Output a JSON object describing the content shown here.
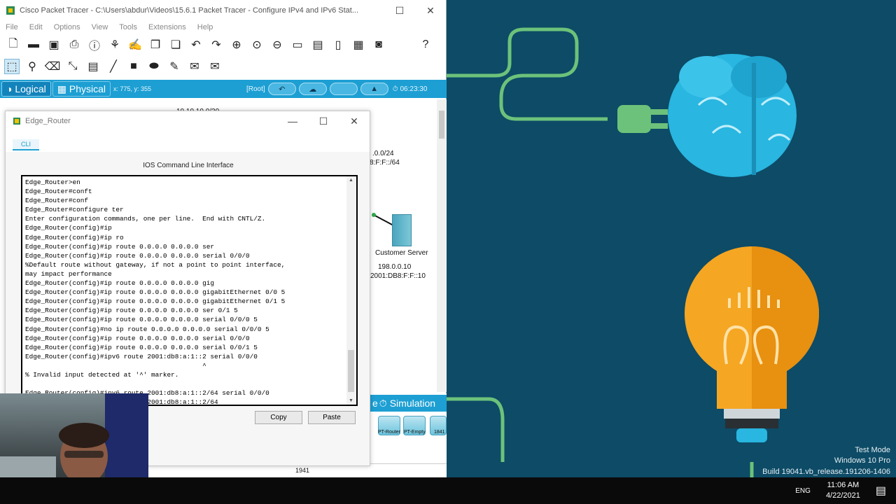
{
  "pt_window": {
    "title": "Cisco Packet Tracer - C:\\Users\\abdur\\Videos\\15.6.1 Packet Tracer - Configure IPv4 and IPv6 Stat...",
    "menu": [
      "File",
      "Edit",
      "Options",
      "View",
      "Tools",
      "Extensions",
      "Help"
    ],
    "help_label": "?"
  },
  "nav": {
    "logical_label": "Logical",
    "physical_label": "Physical",
    "coords": "x: 775, y: 355",
    "root_label": "[Root]",
    "time": "06:23:30"
  },
  "workspace": {
    "top_label": "10.10.10.0/30",
    "net_label_1": ".0.0/24",
    "net_label_2": "8:F:F::/64",
    "server_name": "Customer Server",
    "server_ipv4": "198.0.0.10",
    "server_ipv6": "2001:DB8:F:F::10",
    "bottom_device": "1941",
    "simulation_label": "Simulation",
    "realtime_partial": "e",
    "devices": [
      "PT-Router",
      "PT-Empty",
      "1841"
    ]
  },
  "dialog": {
    "title": "Edge_Router",
    "cli_tab": "CLI",
    "heading": "IOS Command Line Interface",
    "copy_label": "Copy",
    "paste_label": "Paste",
    "terminal_lines": [
      "Edge_Router>en",
      "Edge_Router#conft",
      "Edge_Router#conf",
      "Edge_Router#configure ter",
      "Enter configuration commands, one per line.  End with CNTL/Z.",
      "Edge_Router(config)#ip",
      "Edge_Router(config)#ip ro",
      "Edge_Router(config)#ip route 0.0.0.0 0.0.0.0 ser",
      "Edge_Router(config)#ip route 0.0.0.0 0.0.0.0 serial 0/0/0",
      "%Default route without gateway, if not a point to point interface,",
      "may impact performance",
      "Edge_Router(config)#ip route 0.0.0.0 0.0.0.0 gig",
      "Edge_Router(config)#ip route 0.0.0.0 0.0.0.0 gigabitEthernet 0/0 5",
      "Edge_Router(config)#ip route 0.0.0.0 0.0.0.0 gigabitEthernet 0/1 5",
      "Edge_Router(config)#ip route 0.0.0.0 0.0.0.0 ser 0/1 5",
      "Edge_Router(config)#ip route 0.0.0.0 0.0.0.0 serial 0/0/0 5",
      "Edge_Router(config)#no ip route 0.0.0.0 0.0.0.0 serial 0/0/0 5",
      "Edge_Router(config)#ip route 0.0.0.0 0.0.0.0 serial 0/0/0",
      "Edge_Router(config)#ip route 0.0.0.0 0.0.0.0 serial 0/0/1 5",
      "Edge_Router(config)#ipv6 route 2001:db8:a:1::2 serial 0/0/0",
      "                                             ^",
      "% Invalid input detected at '^' marker.",
      "",
      "Edge_Router(config)#ipv6 route 2001:db8:a:1::2/64 serial 0/0/0",
      "Edge_Router(config)#ipv6 route 2001:db8:a:1::2/64"
    ]
  },
  "watermark": {
    "line1": "Test Mode",
    "line2": "Windows 10 Pro",
    "line3": "Build 19041.vb_release.191206-1406"
  },
  "taskbar": {
    "language": "ENG",
    "time": "11:06 AM",
    "date": "4/22/2021"
  },
  "colors": {
    "pt_blue": "#1d9fd3",
    "bg_teal": "#0d4b66",
    "bulb_orange": "#f5a623",
    "brain_cyan": "#29b6e0",
    "plug_green": "#6cc27a"
  }
}
